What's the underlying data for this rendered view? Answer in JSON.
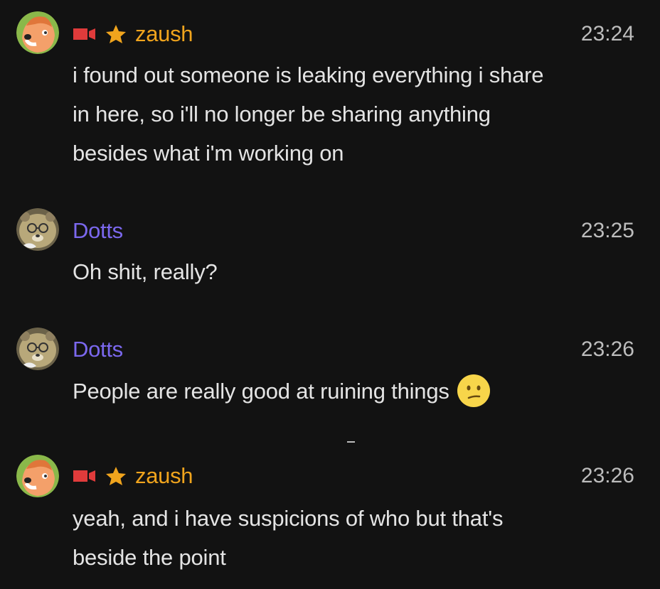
{
  "colors": {
    "background": "#121212",
    "zaush_name": "#f0a41d",
    "dotts_name": "#7b68ee",
    "text": "#e4e4e4",
    "timestamp": "#bdbdbd",
    "camera_icon": "#e03b3b",
    "star_icon": "#f0a41d"
  },
  "messages": [
    {
      "author": "zaush",
      "timestamp": "23:24",
      "badges": [
        "camera-icon",
        "star-icon"
      ],
      "lines": [
        "i found out someone is leaking everything i share",
        "in here, so i'll no longer be sharing anything",
        "besides what i'm working on"
      ]
    },
    {
      "author": "Dotts",
      "timestamp": "23:25",
      "lines": [
        "Oh shit, really?"
      ]
    },
    {
      "author": "Dotts",
      "timestamp": "23:26",
      "lines": [
        "People are really good at ruining things"
      ],
      "emoji": "confused-face-emoji"
    },
    {
      "author": "zaush",
      "timestamp": "23:26",
      "badges": [
        "camera-icon",
        "star-icon"
      ],
      "lines": [
        "yeah, and i have suspicions of who but that's",
        "beside the point"
      ]
    }
  ]
}
